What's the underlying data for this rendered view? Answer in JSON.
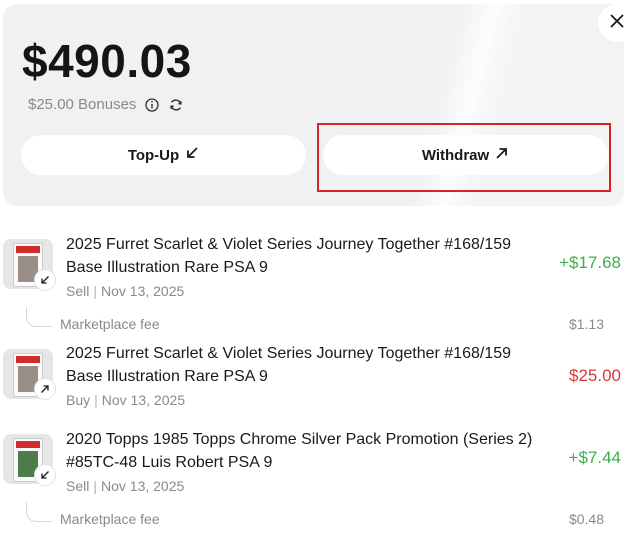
{
  "balance": {
    "amount": "$490.03",
    "bonus_text": "$25.00 Bonuses",
    "info_icon": "info-icon",
    "refresh_icon": "refresh-icon"
  },
  "actions": {
    "topup_label": "Top-Up",
    "topup_icon": "arrow-down-left-icon",
    "withdraw_label": "Withdraw",
    "withdraw_icon": "arrow-up-right-icon"
  },
  "close_icon": "close-icon",
  "transactions": [
    {
      "title": "2025 Furret Scarlet & Violet Series Journey Together #168/159 Base Illustration Rare PSA 9",
      "type": "Sell",
      "date": "Nov 13, 2025",
      "amount": "+$17.68",
      "direction": "incoming",
      "fee_label": "Marketplace fee",
      "fee_amount": "$1.13"
    },
    {
      "title": "2025 Furret Scarlet & Violet Series Journey Together #168/159 Base Illustration Rare PSA 9",
      "type": "Buy",
      "date": "Nov 13, 2025",
      "amount": "$25.00",
      "direction": "outgoing"
    },
    {
      "title": "2020 Topps 1985 Topps Chrome Silver Pack Promotion (Series 2) #85TC-48 Luis Robert PSA 9",
      "type": "Sell",
      "date": "Nov 13, 2025",
      "amount": "+$7.44",
      "direction": "incoming",
      "fee_label": "Marketplace fee",
      "fee_amount": "$0.48"
    }
  ],
  "colors": {
    "positive": "#3fae4a",
    "negative": "#d8383a",
    "highlight": "#d4242a",
    "card_bg": "#f1f1f1"
  }
}
